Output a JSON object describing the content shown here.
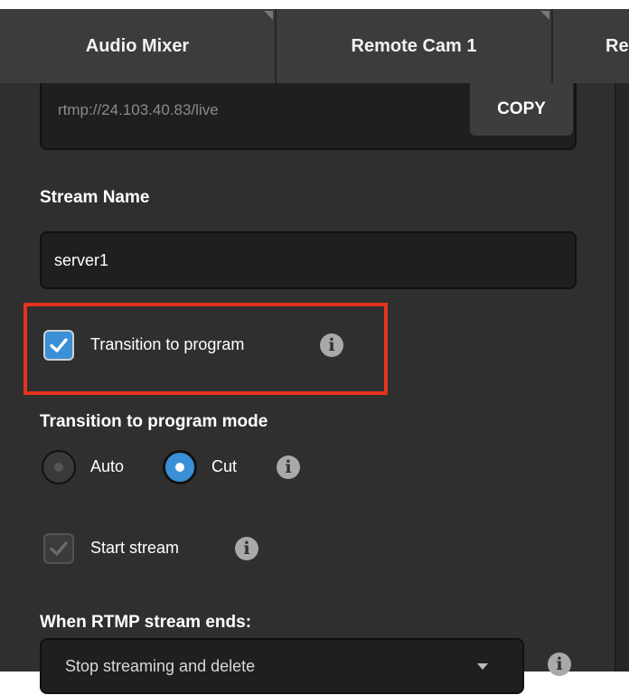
{
  "tabs": [
    {
      "label": "Audio Mixer"
    },
    {
      "label": "Remote Cam 1"
    },
    {
      "label": "Re"
    }
  ],
  "rtmp": {
    "url": "rtmp://24.103.40.83/live",
    "copy_label": "COPY"
  },
  "stream_name": {
    "label": "Stream Name",
    "value": "server1"
  },
  "transition_to_program": {
    "label": "Transition to program",
    "checked": true,
    "info_icon": "i"
  },
  "transition_mode": {
    "label": "Transition to program mode",
    "options": [
      {
        "label": "Auto",
        "selected": false
      },
      {
        "label": "Cut",
        "selected": true
      }
    ],
    "info_icon": "i"
  },
  "start_stream": {
    "label": "Start stream",
    "checked": true,
    "disabled": true,
    "info_icon": "i"
  },
  "rtmp_end": {
    "label": "When RTMP stream ends:",
    "selected": "Stop streaming and delete",
    "info_icon": "i"
  },
  "colors": {
    "panel": "#2f2f2f",
    "accent": "#3a8fd6",
    "highlight": "#e6321e"
  }
}
